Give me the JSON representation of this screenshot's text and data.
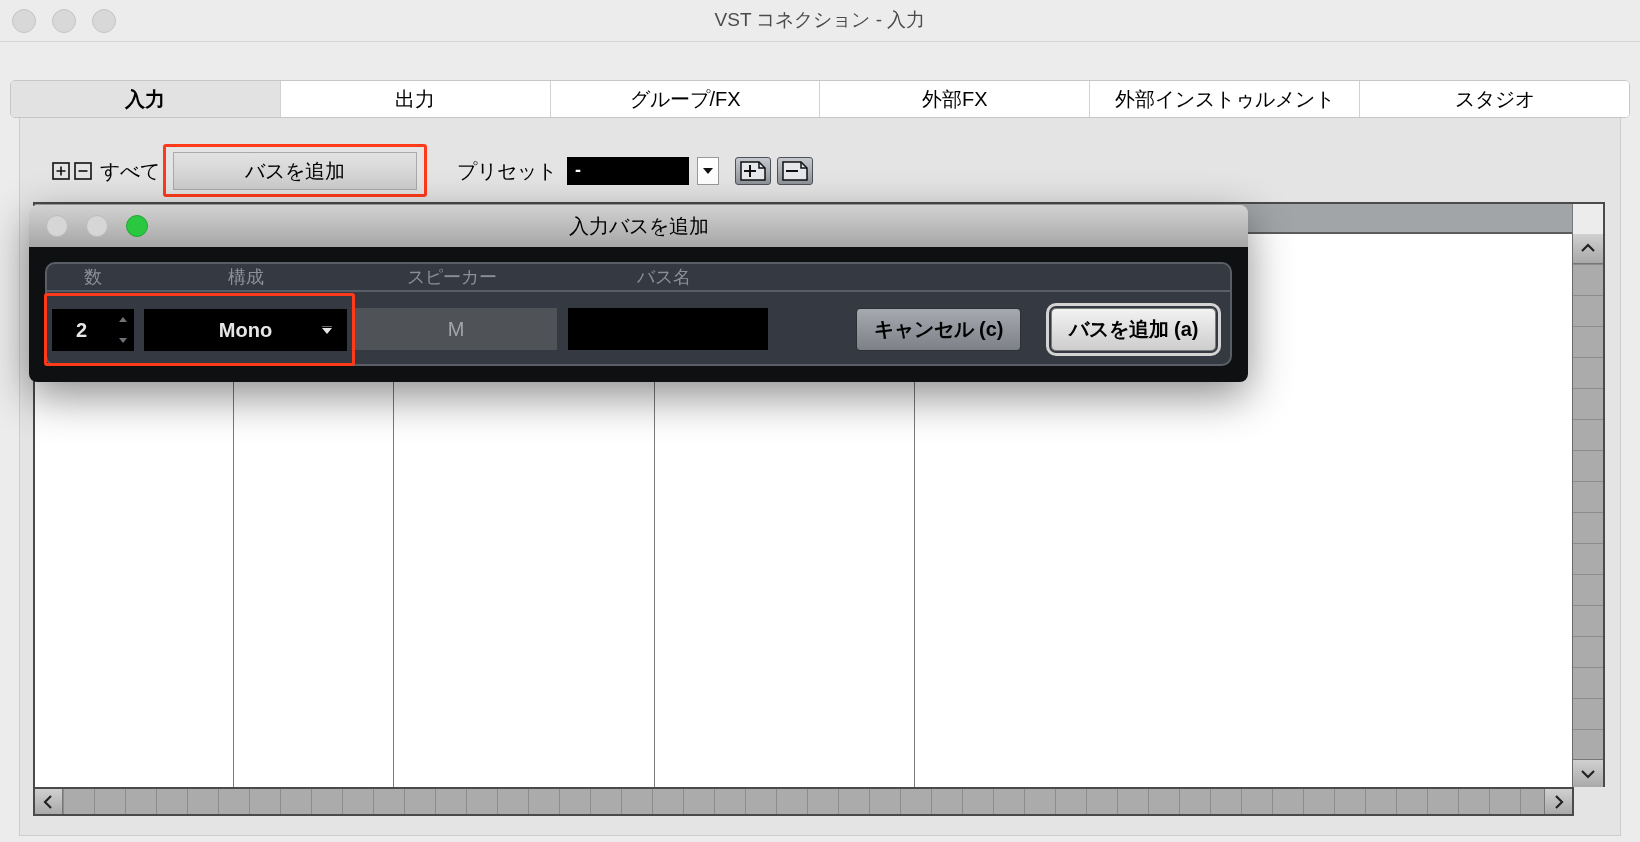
{
  "window": {
    "title": "VST コネクション - 入力"
  },
  "tabs": [
    {
      "label": "入力",
      "selected": true
    },
    {
      "label": "出力",
      "selected": false
    },
    {
      "label": "グループ/FX",
      "selected": false
    },
    {
      "label": "外部FX",
      "selected": false
    },
    {
      "label": "外部インストゥルメント",
      "selected": false
    },
    {
      "label": "スタジオ",
      "selected": false
    }
  ],
  "toolbar": {
    "all_label": "すべて",
    "add_bus_button": {
      "label": "バスを追加",
      "highlighted": true
    },
    "preset": {
      "label": "プリセット",
      "value": "-"
    }
  },
  "dialog": {
    "title": "入力バスを追加",
    "columns": [
      "数",
      "構成",
      "スピーカー",
      "バス名"
    ],
    "count": "2",
    "configuration": "Mono",
    "controls_highlighted": true,
    "speaker": {
      "value": "M",
      "disabled": true
    },
    "buttons": [
      {
        "label": "キャンセル (c)",
        "default": false
      },
      {
        "label": "バスを追加 (a)",
        "default": true
      }
    ]
  }
}
